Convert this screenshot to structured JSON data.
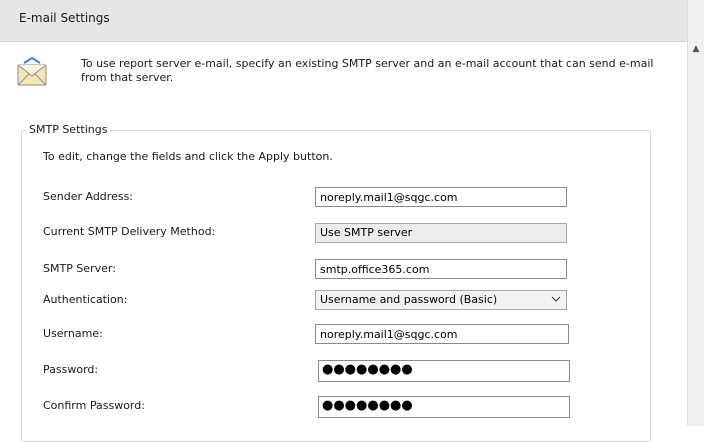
{
  "window": {
    "title": "E-mail Settings"
  },
  "intro": {
    "text": "To use report server e-mail, specify an existing SMTP server and an e-mail account that can send e-mail from that server."
  },
  "smtp_settings": {
    "group_title": "SMTP Settings",
    "instruction": "To edit, change the fields and click the Apply button.",
    "sender_address": {
      "label": "Sender Address:",
      "value": "noreply.mail1@sqgc.com"
    },
    "delivery_method": {
      "label": "Current SMTP Delivery Method:",
      "value": "Use SMTP server"
    },
    "smtp_server": {
      "label": "SMTP Server:",
      "value": "smtp.office365.com"
    },
    "authentication": {
      "label": "Authentication:",
      "value": "Username and password (Basic)"
    },
    "username": {
      "label": "Username:",
      "value": "noreply.mail1@sqgc.com"
    },
    "password": {
      "label": "Password:",
      "masked": "●●●●●●●●"
    },
    "confirm_password": {
      "label": "Confirm Password:",
      "masked": "●●●●●●●●"
    }
  },
  "icons": {
    "intro": "envelope-icon",
    "chevron": "chevron-down-icon",
    "scroll": "scroll-up-arrow-icon"
  }
}
